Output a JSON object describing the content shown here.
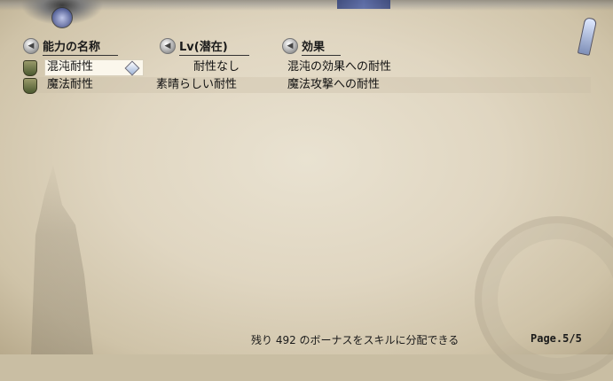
{
  "headers": {
    "name": "能力の名称",
    "level": "Lv(潜在)",
    "effect": "効果"
  },
  "rows": [
    {
      "name": "混沌耐性",
      "level": "耐性なし",
      "effect": "混沌の効果への耐性",
      "selected": true
    },
    {
      "name": "魔法耐性",
      "level": "素晴らしい耐性",
      "effect": "魔法攻撃への耐性",
      "selected": false
    }
  ],
  "footer": {
    "message": "残り 492 のボーナスをスキルに分配できる",
    "page": "Page.5/5"
  },
  "colors": {
    "parchment": "#e3d9c4",
    "text": "#111111",
    "selected_bg": "#fbf7ec"
  }
}
